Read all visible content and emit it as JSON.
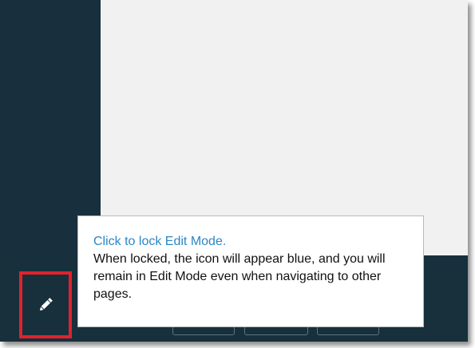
{
  "tooltip": {
    "title": "Click to lock Edit Mode.",
    "body": "When locked, the icon will appear blue, and you will remain in Edit Mode even when navigating to other pages."
  },
  "colors": {
    "tooltip_title": "#2c86c5",
    "highlight_border": "#e3212c",
    "sidebar": "#18303d",
    "content_background": "#f1f1f1"
  },
  "icons": {
    "edit": "pencil-icon"
  }
}
